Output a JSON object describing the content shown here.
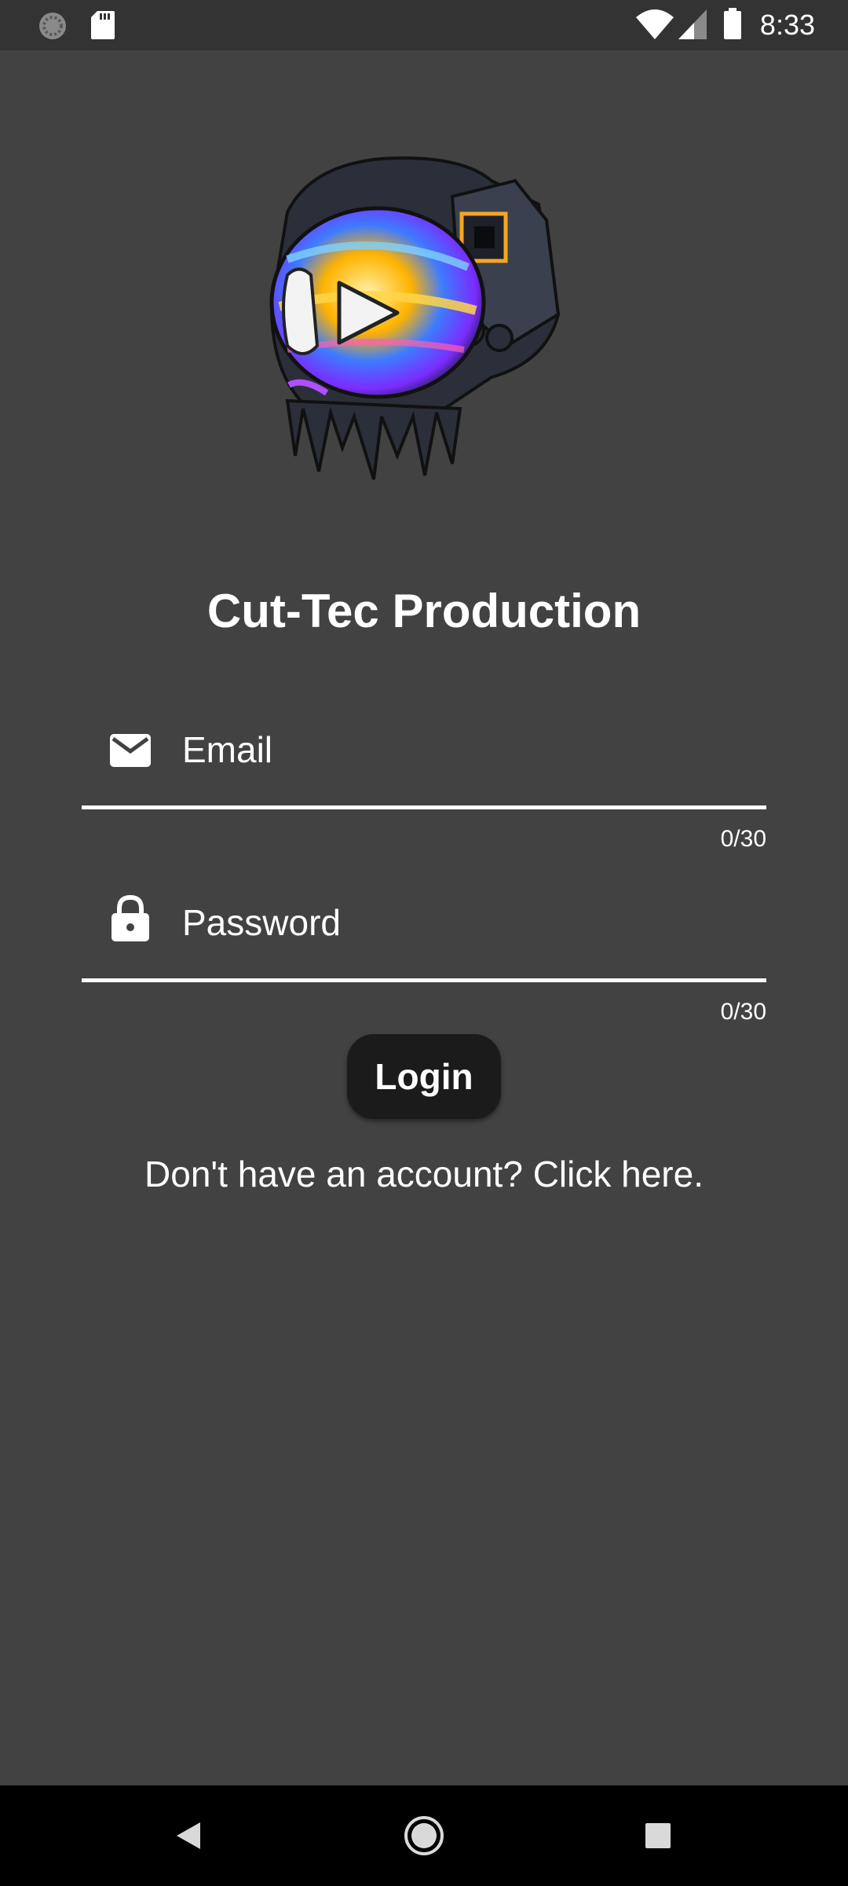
{
  "status_bar": {
    "time": "8:33",
    "icons": [
      "sync-icon",
      "sd-card-icon",
      "wifi-icon",
      "signal-icon",
      "battery-icon"
    ]
  },
  "logo": {
    "icon": "astronaut-helmet-play-logo"
  },
  "app_title": "Cut-Tec Production",
  "email_field": {
    "icon": "email-icon",
    "placeholder": "Email",
    "value": "",
    "counter": "0/30"
  },
  "password_field": {
    "icon": "lock-icon",
    "placeholder": "Password",
    "value": "",
    "counter": "0/30"
  },
  "login_button": {
    "label": "Login"
  },
  "signup_link": {
    "text": "Don't have an account? Click here."
  },
  "nav_bar": {
    "back": "back-triangle-icon",
    "home": "home-circle-icon",
    "recents": "recents-square-icon"
  },
  "colors": {
    "background": "#424242",
    "status_bar": "#333333",
    "button": "#1b1b1b",
    "nav_bar": "#000000",
    "text": "#ffffff"
  }
}
